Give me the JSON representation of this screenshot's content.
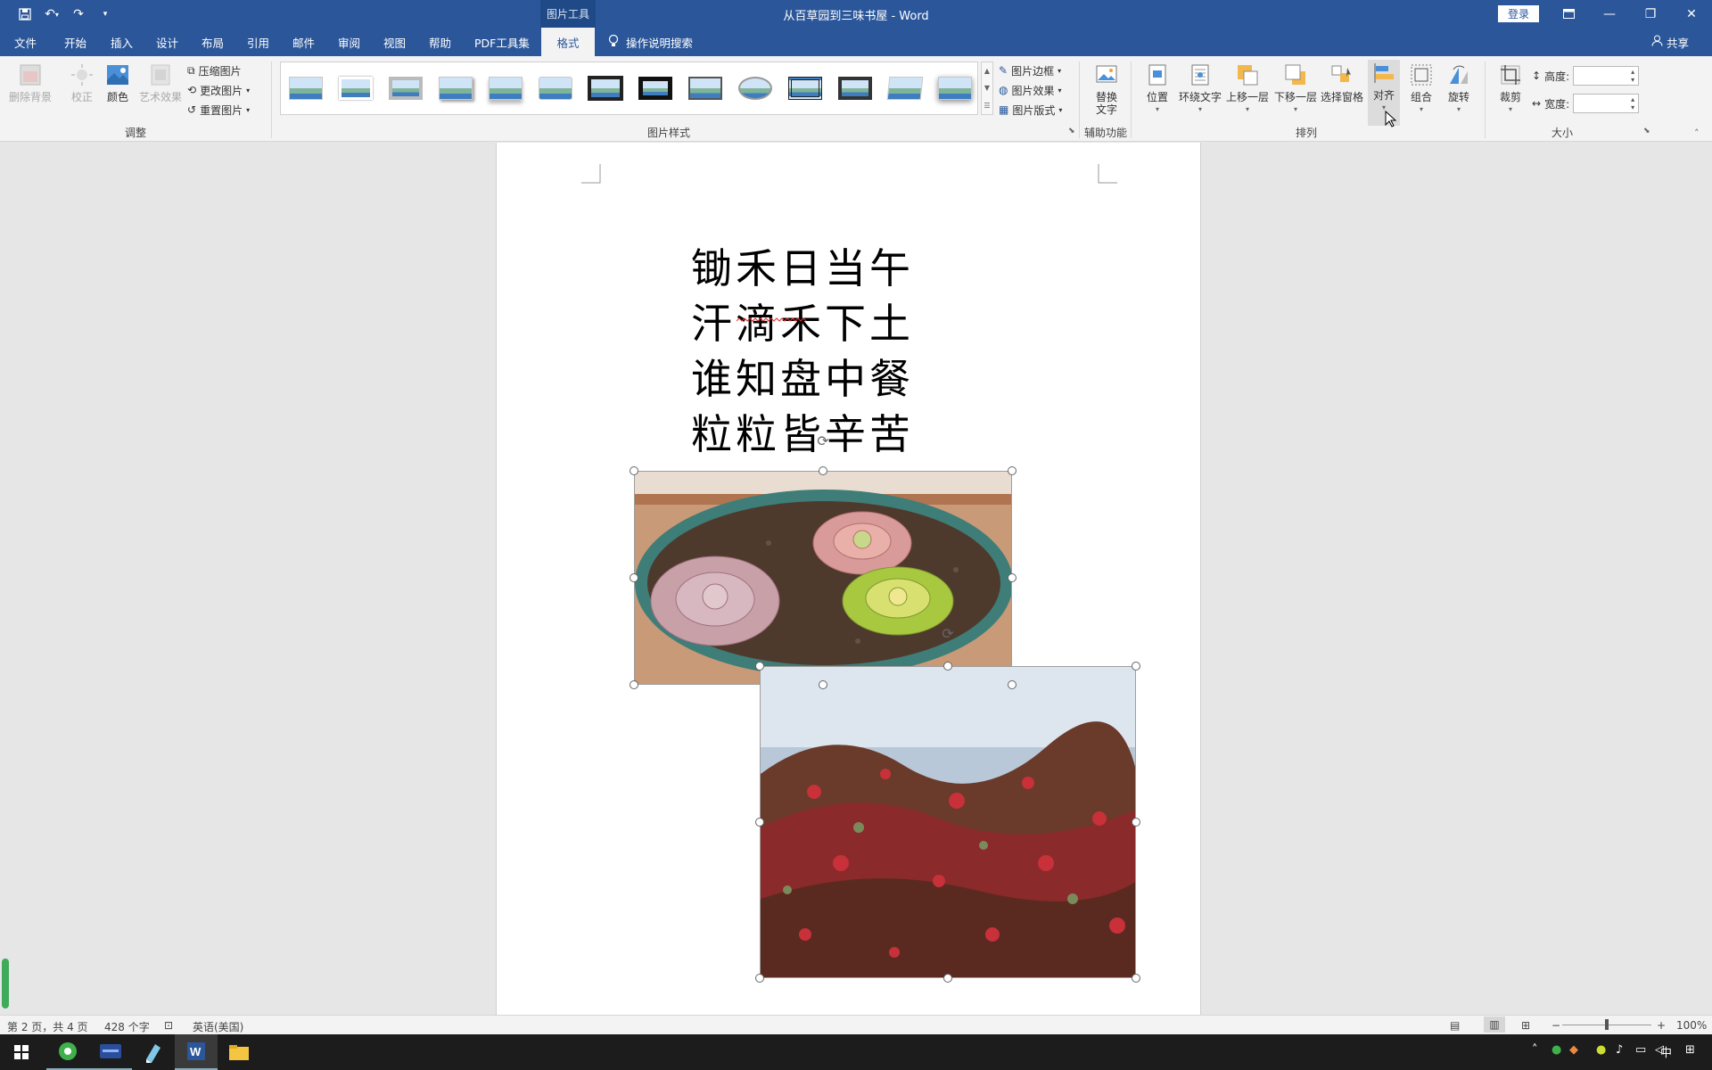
{
  "window": {
    "title": "从百草园到三味书屋  -  Word",
    "context_tab_group": "图片工具",
    "login_label": "登录"
  },
  "menu": {
    "tabs": [
      "文件",
      "开始",
      "插入",
      "设计",
      "布局",
      "引用",
      "邮件",
      "审阅",
      "视图",
      "帮助",
      "PDF工具集",
      "格式"
    ],
    "active_tab": "格式",
    "search_label": "操作说明搜索",
    "share_label": "共享"
  },
  "ribbon": {
    "adjust": {
      "remove_bg": "删除背景",
      "correct": "校正",
      "color": "颜色",
      "artistic": "艺术效果",
      "compress": "压缩图片",
      "change": "更改图片",
      "reset": "重置图片",
      "group_label": "调整"
    },
    "styles": {
      "border": "图片边框",
      "effects": "图片效果",
      "layout": "图片版式",
      "group_label": "图片样式"
    },
    "accessibility": {
      "alt_text": "替换文字",
      "group_label": "辅助功能"
    },
    "arrange": {
      "position": "位置",
      "wrap": "环绕文字",
      "forward": "上移一层",
      "backward": "下移一层",
      "selection_pane": "选择窗格",
      "align": "对齐",
      "group": "组合",
      "rotate": "旋转",
      "group_label": "排列"
    },
    "size": {
      "crop": "裁剪",
      "height_label": "高度:",
      "width_label": "宽度:",
      "height_value": "",
      "width_value": "",
      "group_label": "大小"
    }
  },
  "document": {
    "poem_lines": [
      "锄禾日当午",
      "汗滴禾下土",
      "谁知盘中餐",
      "粒粒皆辛苦"
    ]
  },
  "status": {
    "page": "第 2 页，共 4 页",
    "words": "428 个字",
    "language": "英语(美国)",
    "zoom": "100%"
  },
  "taskbar": {
    "ime": "中"
  },
  "colors": {
    "brand": "#2b579a",
    "ribbon_bg": "#f3f3f3",
    "taskbar": "#1c1c1c"
  }
}
